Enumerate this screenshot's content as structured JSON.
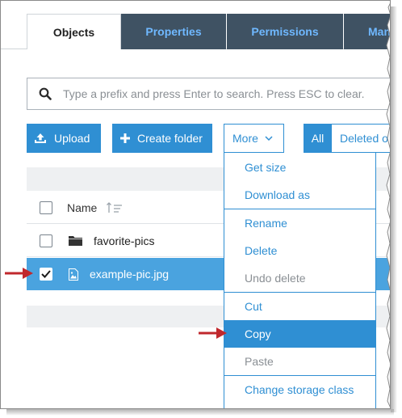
{
  "tabs": [
    {
      "label": "Objects",
      "active": true
    },
    {
      "label": "Properties",
      "active": false
    },
    {
      "label": "Permissions",
      "active": false
    },
    {
      "label": "Man",
      "active": false
    }
  ],
  "search": {
    "placeholder": "Type a prefix and press Enter to search. Press ESC to clear."
  },
  "toolbar": {
    "upload_label": "Upload",
    "create_folder_label": "Create folder",
    "more_label": "More",
    "filter_all_label": "All",
    "filter_deleted_label": "Deleted o"
  },
  "table": {
    "name_header": "Name",
    "rows": [
      {
        "name": "favorite-pics",
        "type": "folder",
        "selected": false
      },
      {
        "name": "example-pic.jpg",
        "type": "image",
        "selected": true
      }
    ]
  },
  "more_menu": {
    "items": [
      {
        "label": "Get size",
        "state": "enabled"
      },
      {
        "label": "Download as",
        "state": "enabled"
      },
      {
        "label": "Rename",
        "state": "enabled"
      },
      {
        "label": "Delete",
        "state": "enabled"
      },
      {
        "label": "Undo delete",
        "state": "disabled"
      },
      {
        "label": "Cut",
        "state": "enabled"
      },
      {
        "label": "Copy",
        "state": "highlighted"
      },
      {
        "label": "Paste",
        "state": "disabled"
      },
      {
        "label": "Change storage class",
        "state": "enabled"
      }
    ]
  },
  "colors": {
    "accent": "#2f8fd3",
    "selected_row": "#4aa3df",
    "tab_inactive_bg": "#3f5263",
    "tab_inactive_text": "#6fb8ff",
    "annotation_arrow": "#c0282d"
  },
  "icons": [
    "search-icon",
    "upload-icon",
    "plus-icon",
    "chevron-down-icon",
    "sort-icon",
    "folder-icon",
    "image-file-icon",
    "checkmark-icon",
    "annotation-arrow"
  ]
}
